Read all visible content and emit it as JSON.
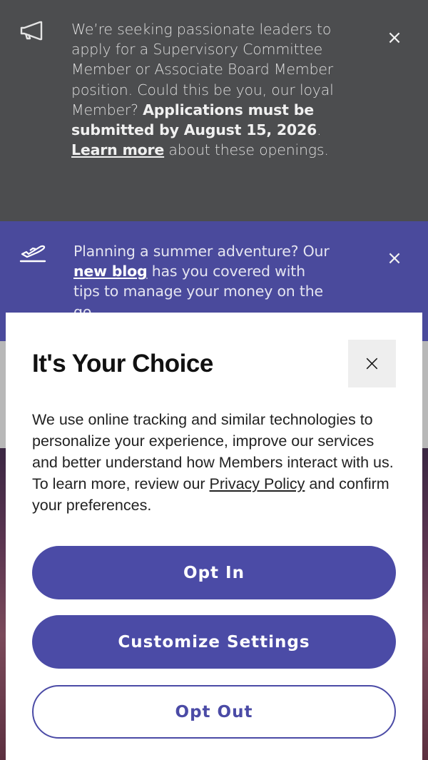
{
  "banner1": {
    "icon": "megaphone-icon",
    "text_pre": "We’re seeking passionate leaders to apply for a Supervisory Committee Member or Associate Board Member position. Could this be you, our loyal Member? ",
    "text_bold": "Applications must be submitted by August 15, 2026",
    "text_after_bold": ". ",
    "link": "Learn more",
    "text_post": " about these openings.",
    "close": "×"
  },
  "banner2": {
    "icon": "airplane-takeoff-icon",
    "text_pre": "Planning a summer adventure? Our ",
    "link": "new blog",
    "text_post": " has you covered with tips to manage your money on the go.",
    "close": "×"
  },
  "modal": {
    "title": "It's Your Choice",
    "close": "×",
    "body_pre": "We use online tracking and similar technologies to personalize your experience, improve our services and better understand how Members interact with us. To learn more, review our ",
    "body_link": "Privacy Policy",
    "body_post": " and confirm your preferences.",
    "opt_in": "Opt In",
    "customize": "Customize Settings",
    "opt_out": "Opt Out"
  },
  "colors": {
    "banner1_bg": "#4c4d4f",
    "banner2_bg": "#4a4a9c",
    "accent": "#4b4ba6"
  }
}
